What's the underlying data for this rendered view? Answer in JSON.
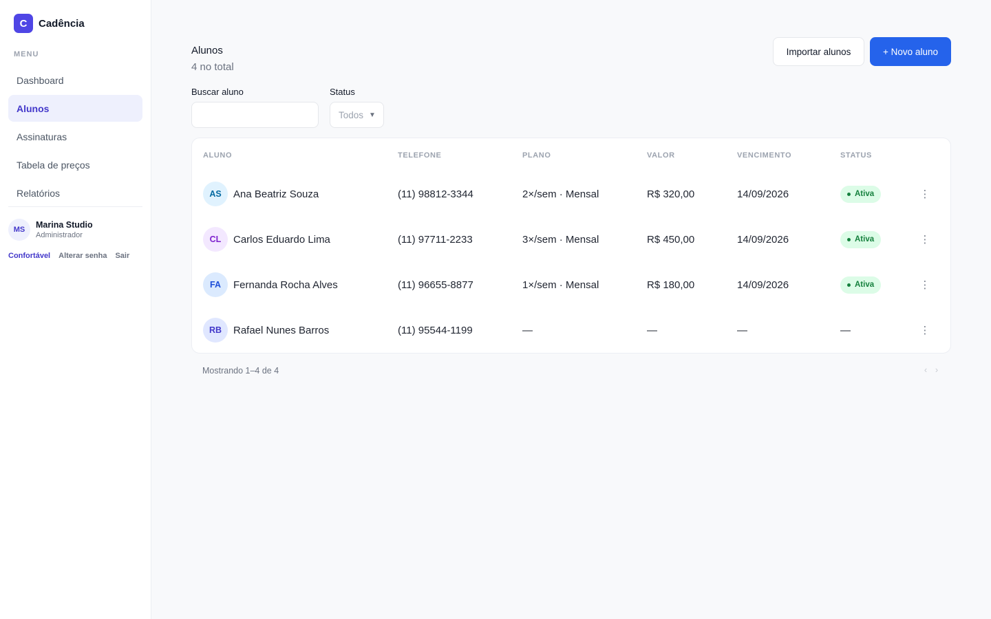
{
  "app": {
    "logo_letter": "C",
    "name": "Cadência"
  },
  "sidebar": {
    "menu_label": "MENU",
    "items": [
      {
        "label": "Dashboard"
      },
      {
        "label": "Alunos"
      },
      {
        "label": "Assinaturas"
      },
      {
        "label": "Tabela de preços"
      },
      {
        "label": "Relatórios"
      }
    ],
    "active_index": 1
  },
  "user": {
    "initials": "MS",
    "name": "Marina Studio",
    "role": "Administrador",
    "links": {
      "density": "Confortável",
      "change_password": "Alterar senha",
      "logout": "Sair"
    }
  },
  "header": {
    "title": "Alunos",
    "count": "4 no total",
    "import_label": "Importar alunos",
    "new_label": "+ Novo aluno"
  },
  "filters": {
    "search_label": "Buscar aluno",
    "search_value": "",
    "status_label": "Status",
    "status_value": "Todos"
  },
  "table": {
    "columns": {
      "aluno": "ALUNO",
      "telefone": "TELEFONE",
      "plano": "PLANO",
      "valor": "VALOR",
      "vencimento": "VENCIMENTO",
      "status": "STATUS"
    },
    "rows": [
      {
        "initials": "AS",
        "name": "Ana Beatriz Souza",
        "phone": "(11) 98812-3344",
        "plan": "2×/sem · Mensal",
        "value": "R$ 320,00",
        "due": "14/09/2026",
        "status": "Ativa",
        "avatar_bg": "#e0f2fe",
        "avatar_fg": "#0369a1"
      },
      {
        "initials": "CL",
        "name": "Carlos Eduardo Lima",
        "phone": "(11) 97711-2233",
        "plan": "3×/sem · Mensal",
        "value": "R$ 450,00",
        "due": "14/09/2026",
        "status": "Ativa",
        "avatar_bg": "#f3e8ff",
        "avatar_fg": "#7e22ce"
      },
      {
        "initials": "FA",
        "name": "Fernanda Rocha Alves",
        "phone": "(11) 96655-8877",
        "plan": "1×/sem · Mensal",
        "value": "R$ 180,00",
        "due": "14/09/2026",
        "status": "Ativa",
        "avatar_bg": "#dbeafe",
        "avatar_fg": "#1d4ed8"
      },
      {
        "initials": "RB",
        "name": "Rafael Nunes Barros",
        "phone": "(11) 95544-1199",
        "plan": "—",
        "value": "—",
        "due": "—",
        "status": "—",
        "avatar_bg": "#e0e7ff",
        "avatar_fg": "#4338ca"
      }
    ]
  },
  "footer": {
    "showing": "Mostrando 1–4 de 4",
    "prev": "‹",
    "next": "›"
  },
  "icons": {
    "row_menu": "kebab-icon",
    "select_caret": "chevron-down-icon"
  },
  "colors": {
    "primary": "#2563eb",
    "brand": "#4f46e5",
    "active_badge_bg": "#dcfce7",
    "active_badge_fg": "#15803d"
  }
}
